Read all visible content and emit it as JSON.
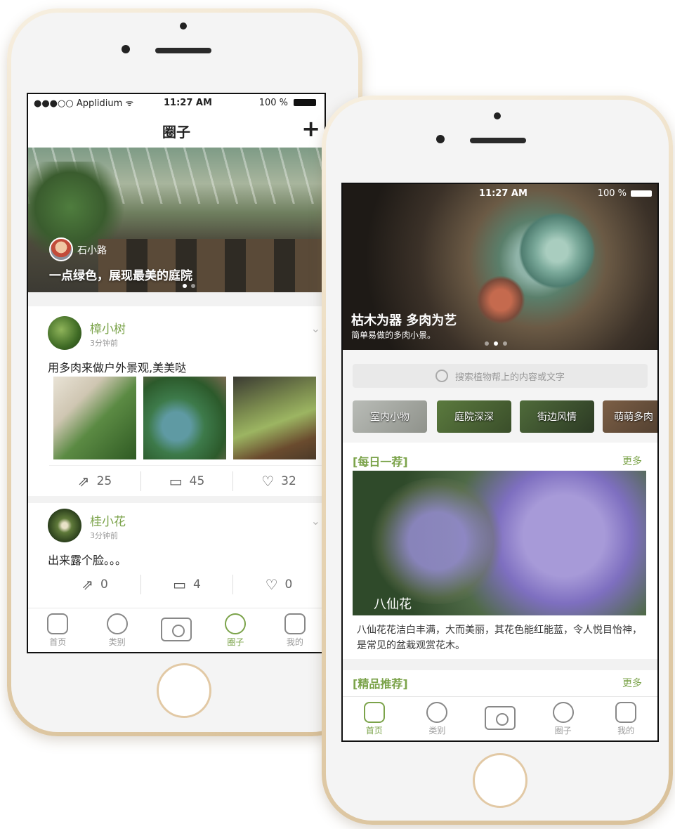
{
  "left_phone": {
    "status": {
      "carrier": "●●●○○ Applidium ᯤ",
      "time": "11:27 AM",
      "battery": "100 %"
    },
    "nav": {
      "title": "圈子",
      "add": "+"
    },
    "banner": {
      "user": "石小路",
      "caption": "一点绿色，展现最美的庭院"
    },
    "posts": [
      {
        "user": "樟小树",
        "time": "3分钟前",
        "text": "用多肉来做户外景观,美美哒",
        "share": "25",
        "comments": "45",
        "likes": "32"
      },
      {
        "user": "桂小花",
        "time": "3分钟前",
        "text": "出来露个脸。。。",
        "share": "0",
        "comments": "4",
        "likes": "0"
      }
    ],
    "tabs": [
      {
        "label": "首页",
        "icon": "home-icon"
      },
      {
        "label": "类别",
        "icon": "category-icon"
      },
      {
        "label": "",
        "icon": "camera-icon"
      },
      {
        "label": "圈子",
        "icon": "circle-icon"
      },
      {
        "label": "我的",
        "icon": "profile-icon"
      }
    ]
  },
  "right_phone": {
    "status": {
      "time": "11:27 AM",
      "battery": "100 %"
    },
    "hero": {
      "title": "枯木为器 多肉为艺",
      "subtitle": "简单易做的多肉小景。"
    },
    "search": {
      "placeholder": "搜索植物帮上的内容或文字"
    },
    "categories": [
      "室内小物",
      "庭院深深",
      "街边风情",
      "萌萌多肉"
    ],
    "daily": {
      "title": "[每日一荐]",
      "more": "更多",
      "flower": "八仙花",
      "desc": "八仙花花洁白丰满，大而美丽，其花色能红能蓝，令人悦目怡神，是常见的盆栽观赏花木。"
    },
    "featured": {
      "title": "[精品推荐]",
      "more": "更多"
    },
    "tabs": [
      {
        "label": "首页",
        "icon": "home-icon"
      },
      {
        "label": "类别",
        "icon": "category-icon"
      },
      {
        "label": "",
        "icon": "camera-icon"
      },
      {
        "label": "圈子",
        "icon": "circle-icon"
      },
      {
        "label": "我的",
        "icon": "profile-icon"
      }
    ]
  },
  "colors": {
    "accent": "#7ba34a",
    "gold": "#e2c9a5"
  }
}
